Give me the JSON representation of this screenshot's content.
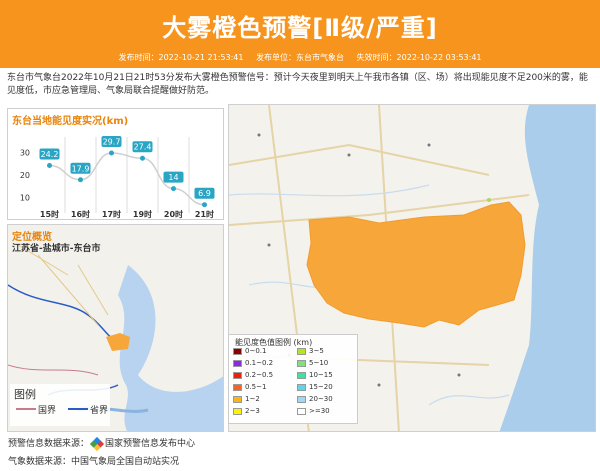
{
  "header": {
    "title": "大雾橙色预警[Ⅱ级/严重]",
    "issue_time_label": "发布时间：",
    "issue_time": "2022-10-21 21:53:41",
    "issuer_label": "发布单位：",
    "issuer": "东台市气象台",
    "expire_label": "失效时间：",
    "expire_time": "2022-10-22 03:53:41",
    "color": "#f7941d"
  },
  "description": "东台市气象台2022年10月21日21时53分发布大雾橙色预警信号：预计今天夜里到明天上午我市各镇（区、场）将出现能见度不足200米的雾，能见度低，市应急管理局、气象局联合提醒做好防范。",
  "visibility_panel": {
    "title": "东台当地能见度实况(km)"
  },
  "chart_data": {
    "type": "line",
    "title": "东台当地能见度实况(km)",
    "categories": [
      "15时",
      "16时",
      "17时",
      "19时",
      "20时",
      "21时"
    ],
    "values": [
      24.2,
      17.9,
      29.7,
      27.4,
      14,
      6.9
    ],
    "data_labels": [
      "24.2",
      "17.9",
      "29.7",
      "27.4",
      "14",
      "6.9"
    ],
    "yticks": [
      "30",
      "20",
      "10"
    ],
    "ylim": [
      5,
      35
    ],
    "grid": true
  },
  "location_panel": {
    "title": "定位概览",
    "region": "江苏省-盐城市-东台市"
  },
  "map_legend": {
    "title": "图例",
    "items": [
      {
        "label": "国界",
        "color": "#c77b8b"
      },
      {
        "label": "省界",
        "color": "#2a5cc7"
      }
    ]
  },
  "visibility_legend": {
    "title": "能见度色值图例 (km)",
    "items": [
      {
        "label": "0~0.1",
        "color": "#8b0000"
      },
      {
        "label": "3~5",
        "color": "#b5e61d"
      },
      {
        "label": "0.1~0.2",
        "color": "#8a2be2"
      },
      {
        "label": "5~10",
        "color": "#7ee07e"
      },
      {
        "label": "0.2~0.5",
        "color": "#e8230a"
      },
      {
        "label": "10~15",
        "color": "#40e0a0"
      },
      {
        "label": "0.5~1",
        "color": "#f26522"
      },
      {
        "label": "15~20",
        "color": "#5fd3e8"
      },
      {
        "label": "1~2",
        "color": "#f7b51d"
      },
      {
        "label": "20~30",
        "color": "#9fd8f0"
      },
      {
        "label": "2~3",
        "color": "#fff200"
      },
      {
        "label": ">=30",
        "color": "#ffffff"
      }
    ]
  },
  "footer": {
    "warning_source_label": "预警信息数据来源：",
    "warning_source": "国家预警信息发布中心",
    "weather_source_label": "气象数据来源：",
    "weather_source": "中国气象局全国自动站实况"
  }
}
